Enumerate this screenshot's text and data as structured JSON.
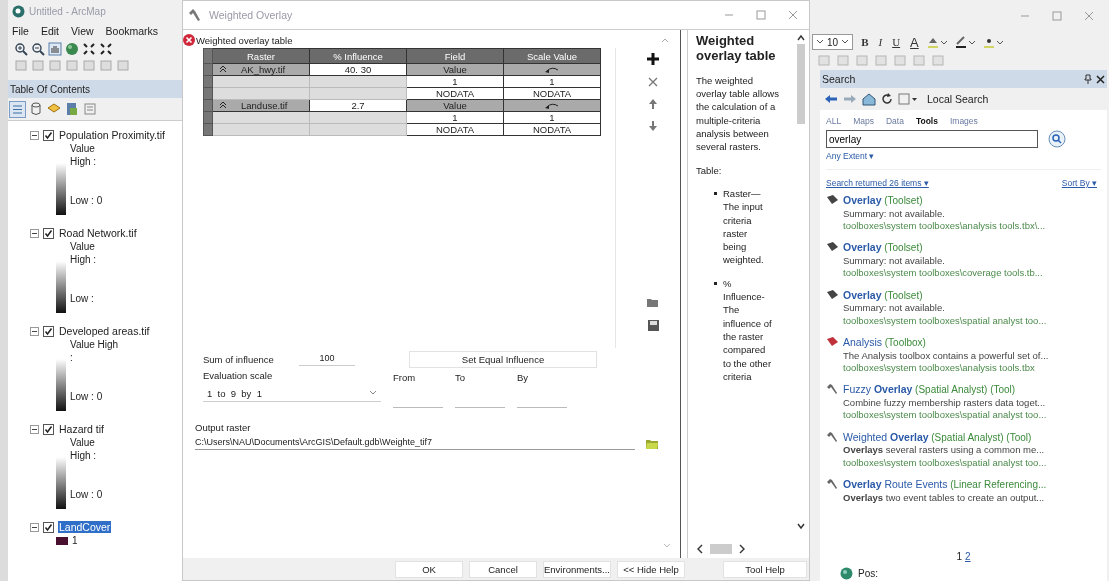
{
  "arcmap": {
    "title": "Untitled - ArcMap",
    "menu": [
      "File",
      "Edit",
      "View",
      "Bookmarks"
    ]
  },
  "toc": {
    "title": "Table Of Contents",
    "layers": [
      {
        "name": "Population Proximity.tif",
        "checked": true,
        "selected": false,
        "kind": "stretched",
        "legend": [
          "Value",
          "High :",
          "Low : 0"
        ]
      },
      {
        "name": "Road Network.tif",
        "checked": true,
        "selected": false,
        "kind": "stretched",
        "legend": [
          "Value",
          "High :",
          "Low :"
        ]
      },
      {
        "name": "Developed areas.tif",
        "checked": true,
        "selected": false,
        "kind": "stretched",
        "legend": [
          "Value High",
          ":",
          "Low : 0"
        ]
      },
      {
        "name": "Hazard tif",
        "checked": true,
        "selected": false,
        "kind": "stretched",
        "legend": [
          "Value",
          "High :",
          "Low : 0"
        ]
      },
      {
        "name": "LandCover",
        "checked": true,
        "selected": true,
        "kind": "unique",
        "legend": [
          "1"
        ]
      }
    ]
  },
  "dialog": {
    "title": "Weighted Overlay",
    "section": "Weighted overlay table",
    "columns": [
      "Raster",
      "% Influence",
      "Field",
      "Scale Value"
    ],
    "rows": [
      {
        "kind": "raster",
        "raster": "AK_hwy.tif",
        "influence": "40. 30",
        "field": "Value"
      },
      {
        "kind": "value",
        "field": "1",
        "scale": "1"
      },
      {
        "kind": "value",
        "field": "NODATA",
        "scale": "NODATA"
      },
      {
        "kind": "raster",
        "raster": "Landuse.tif",
        "influence": "2.7",
        "field": "Value"
      },
      {
        "kind": "value",
        "field": "1",
        "scale": "1"
      },
      {
        "kind": "value",
        "field": "NODATA",
        "scale": "NODATA"
      }
    ],
    "sum_label": "Sum of influence",
    "sum": "100",
    "equal_button": "Set Equal Influence",
    "scale_label": "Evaluation scale",
    "scale_value": "1  to  9  by  1",
    "range_labels": [
      "From",
      "To",
      "By"
    ],
    "output_label": "Output raster",
    "output_value": "C:\\Users\\NAU\\Documents\\ArcGIS\\Default.gdb\\Weighte_tif7",
    "buttons": [
      "OK",
      "Cancel",
      "Environments...",
      "<< Hide Help"
    ]
  },
  "help": {
    "title": "Weighted overlay table",
    "intro": "The weighted overlay table allows the calculation of a multiple-criteria analysis between several rasters.",
    "table_label": "Table:",
    "bullets": [
      "Raster—The input criteria raster being weighted.",
      "% Influence-The influence of the raster compared to the other criteria"
    ],
    "button": "Tool Help"
  },
  "format": {
    "font_size": "10",
    "buttons": [
      "B",
      "I",
      "U",
      "A"
    ]
  },
  "search": {
    "title": "Search",
    "scope": "Local Search",
    "tabs": [
      {
        "label": "ALL",
        "selected": false
      },
      {
        "label": "Maps",
        "selected": false
      },
      {
        "label": "Data",
        "selected": false
      },
      {
        "label": "Tools",
        "selected": true
      },
      {
        "label": "Images",
        "selected": false
      }
    ],
    "query": "overlay",
    "extent": "Any Extent ▾",
    "summary": "Search returned 26 items ▾",
    "sort": "Sort By ▾",
    "results": [
      {
        "kind": "toolset",
        "title": "**Overlay**",
        "type": "(Toolset)",
        "summary": "Summary: not available.",
        "path": "toolboxes\\system toolboxes\\analysis tools.tbx\\..."
      },
      {
        "kind": "toolset",
        "title": "**Overlay**",
        "type": "(Toolset)",
        "summary": "Summary: not available.",
        "path": "toolboxes\\system toolboxes\\coverage tools.tb..."
      },
      {
        "kind": "toolset",
        "title": "**Overlay**",
        "type": "(Toolset)",
        "summary": "Summary: not available.",
        "path": "toolboxes\\system toolboxes\\spatial analyst too..."
      },
      {
        "kind": "toolbox",
        "title": "Analysis",
        "type": "(Toolbox)",
        "summary": "The Analysis toolbox contains a powerful set of...",
        "path": "toolboxes\\system toolboxes\\analysis tools.tbx"
      },
      {
        "kind": "tool",
        "title": "Fuzzy **Overlay**",
        "type": "(Spatial Analyst) (Tool)",
        "summary": "Combine fuzzy membership rasters data toget...",
        "path": "toolboxes\\system toolboxes\\spatial analyst too..."
      },
      {
        "kind": "tool",
        "title": "Weighted **Overlay**",
        "type": "(Spatial Analyst) (Tool)",
        "summary": "**Overlays** several rasters using a common me...",
        "path": "toolboxes\\system toolboxes\\spatial analyst too..."
      },
      {
        "kind": "tool",
        "title": "**Overlay** Route Events",
        "type": "(Linear Referencing...",
        "summary": "**Overlays** two event tables to create an output..."
      }
    ],
    "pages": [
      {
        "label": "1",
        "selected": true
      },
      {
        "label": "2",
        "selected": false
      }
    ],
    "location": "Pos:"
  }
}
